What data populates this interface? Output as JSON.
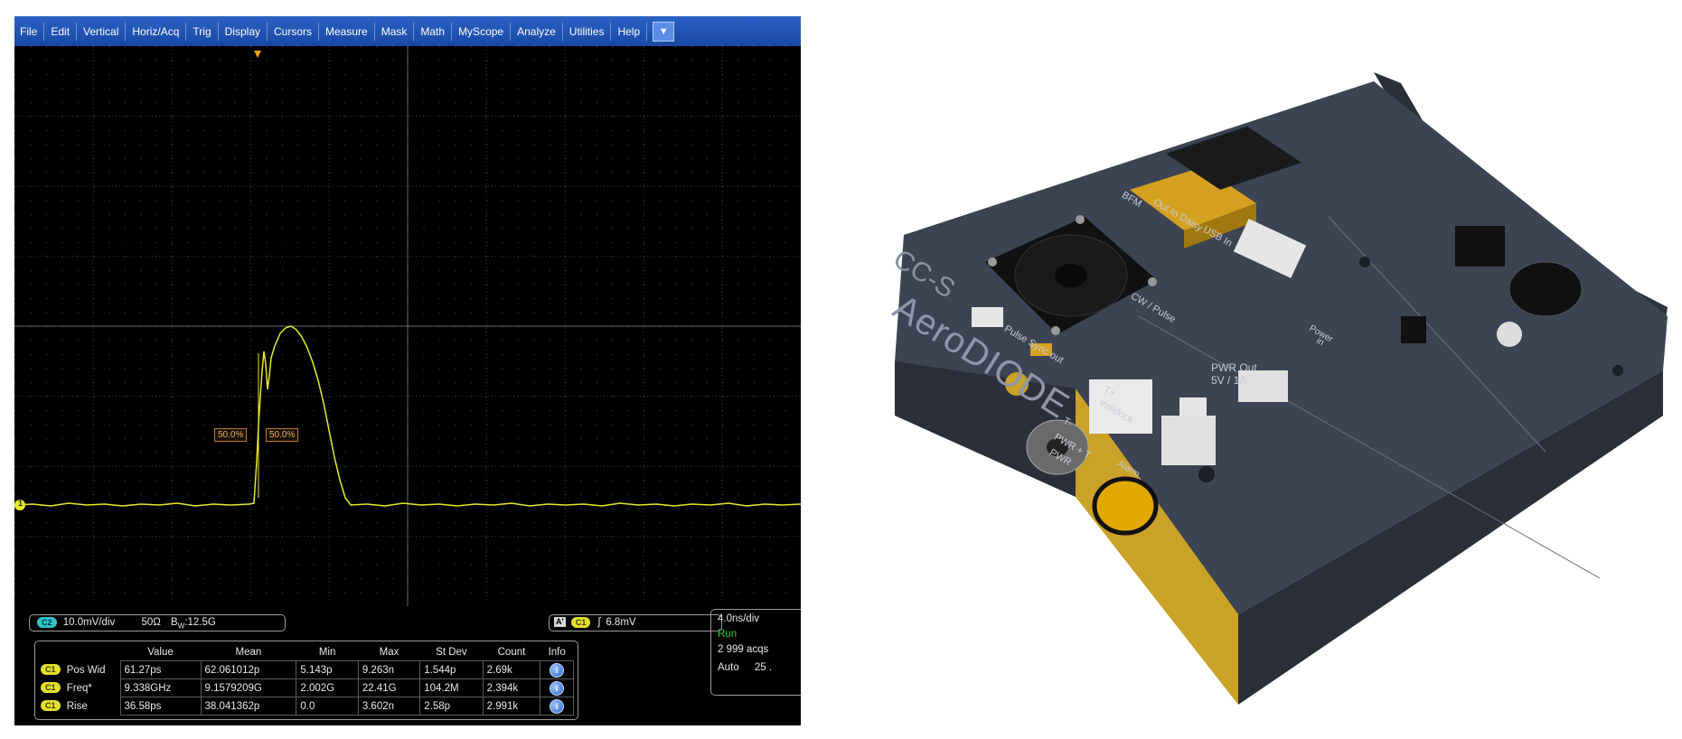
{
  "menu": {
    "items": [
      "File",
      "Edit",
      "Vertical",
      "Horiz/Acq",
      "Trig",
      "Display",
      "Cursors",
      "Measure",
      "Mask",
      "Math",
      "MyScope",
      "Analyze",
      "Utilities",
      "Help"
    ],
    "dropdown_glyph": "▼"
  },
  "waveform": {
    "channel_marker": "1",
    "cursor_left_label": "50.0%",
    "cursor_right_label": "50.0%",
    "trace_color": "#e8e82a"
  },
  "channel": {
    "badge": "C2",
    "scale": "10.0mV/div",
    "impedance": "50Ω",
    "bw_prefix": "B",
    "bw_sub": "W",
    "bw_value": ":12.5G"
  },
  "trigger": {
    "mode_badge": "A'",
    "badge": "C1",
    "slope_glyph": "ʃ",
    "level": "6.8mV"
  },
  "acq": {
    "timebase": "4.0ns/div",
    "state": "Run",
    "acqs": "2 999 acqs",
    "mode": "Auto",
    "extra": "25 ."
  },
  "measurements": {
    "headers": [
      "",
      "Value",
      "Mean",
      "Min",
      "Max",
      "St Dev",
      "Count",
      "Info"
    ],
    "rows": [
      {
        "badge": "C1",
        "label": "Pos Wid",
        "value": "61.27ps",
        "mean": "62.061012p",
        "min": "5.143p",
        "max": "9.263n",
        "stdev": "1.544p",
        "count": "2.69k"
      },
      {
        "badge": "C1",
        "label": "Freq*",
        "value": "9.338GHz",
        "mean": "9.1579209G",
        "min": "2.002G",
        "max": "22.41G",
        "stdev": "104.2M",
        "count": "2.394k"
      },
      {
        "badge": "C1",
        "label": "Rise",
        "value": "36.58ps",
        "mean": "38.041362p",
        "min": "0.0",
        "max": "3.602n",
        "stdev": "2.58p",
        "count": "2.991k"
      }
    ],
    "info_glyph": "i"
  },
  "device": {
    "brand": "CC-S",
    "name": "AeroDIODE",
    "labels": {
      "bfm": "BFM",
      "out_in_daisy": "Out In Daisy",
      "usb_in": "USB In",
      "cw_pulse": "CW / Pulse",
      "pulse_sync_out": "Pulse Sync out",
      "pwr_out": "PWR Out",
      "pwr_out_spec": "5V / 1A",
      "power_in": "Power",
      "power_in2": "in",
      "interlock": "Interlock",
      "t_plus": "T+",
      "t_minus": "T-",
      "pwr_t": "PWR + T",
      "pwr": "PWR",
      "alarm": "Alarm"
    },
    "colors": {
      "body": "#3c4353",
      "accent": "#c9a227"
    }
  }
}
